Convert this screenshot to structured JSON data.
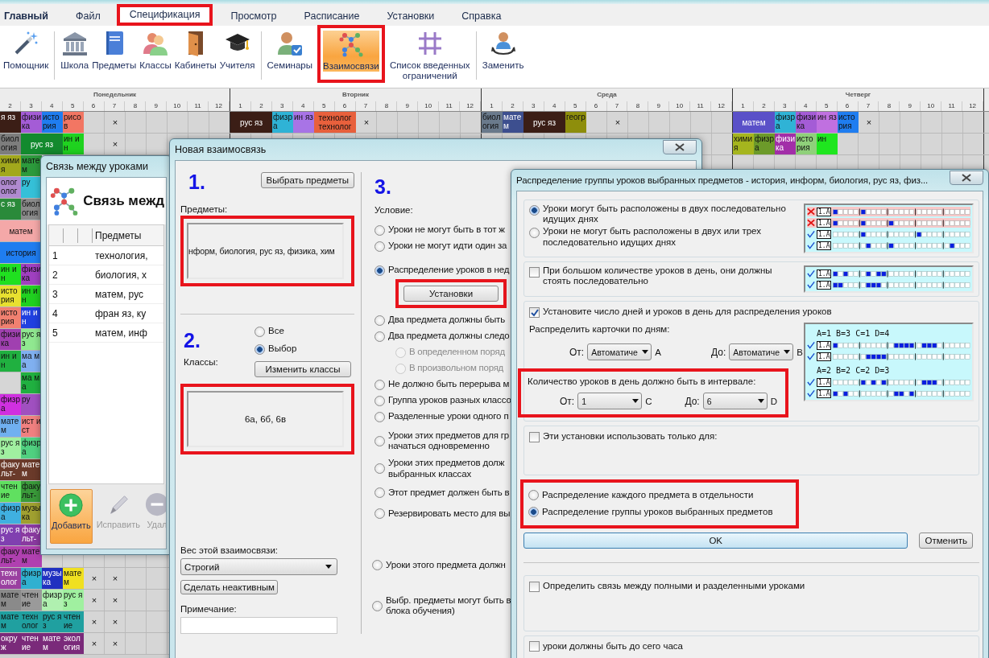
{
  "menu": [
    {
      "kind": "app",
      "label": "Главный",
      "selected": false,
      "highlighted": false
    },
    {
      "kind": "tab",
      "label": "Файл",
      "selected": false,
      "highlighted": false
    },
    {
      "kind": "tab",
      "label": "Спецификация",
      "selected": true,
      "highlighted": true
    },
    {
      "kind": "tab",
      "label": "Просмотр",
      "selected": false,
      "highlighted": false
    },
    {
      "kind": "tab",
      "label": "Расписание",
      "selected": false,
      "highlighted": false
    },
    {
      "kind": "tab",
      "label": "Установки",
      "selected": false,
      "highlighted": false
    },
    {
      "kind": "tab",
      "label": "Справка",
      "selected": false,
      "highlighted": false
    }
  ],
  "ribbon": [
    {
      "kind": "button",
      "label": "Помощник",
      "selected": false,
      "highlighted": false
    },
    {
      "kind": "separator"
    },
    {
      "kind": "button",
      "label": "Школа",
      "selected": false,
      "highlighted": false
    },
    {
      "kind": "button",
      "label": "Предметы",
      "selected": false,
      "highlighted": false
    },
    {
      "kind": "button",
      "label": "Классы",
      "selected": false,
      "highlighted": false
    },
    {
      "kind": "button",
      "label": "Кабинеты",
      "selected": false,
      "highlighted": false
    },
    {
      "kind": "button",
      "label": "Учителя",
      "selected": false,
      "highlighted": false
    },
    {
      "kind": "separator"
    },
    {
      "kind": "button",
      "label": "Семинары",
      "selected": false,
      "highlighted": false
    },
    {
      "kind": "button",
      "label": "Взаимосвязи",
      "selected": true,
      "highlighted": true
    },
    {
      "kind": "button",
      "label": "Список введенных ограничений",
      "selected": false,
      "highlighted": false
    },
    {
      "kind": "separator"
    },
    {
      "kind": "button",
      "label": "Заменить",
      "selected": false,
      "highlighted": false
    }
  ],
  "timetable": {
    "days": [
      {
        "name": "Понедельник",
        "periods": [
          "2",
          "3",
          "4",
          "5",
          "6",
          "7",
          "8",
          "9",
          "10",
          "11",
          "12"
        ]
      },
      {
        "name": "Вторник",
        "periods": [
          "1",
          "2",
          "3",
          "4",
          "5",
          "6",
          "7",
          "8",
          "9",
          "10",
          "11",
          "12"
        ]
      },
      {
        "name": "Среда",
        "periods": [
          "1",
          "2",
          "3",
          "4",
          "5",
          "6",
          "7",
          "8",
          "9",
          "10",
          "11",
          "12"
        ]
      },
      {
        "name": "Четверг",
        "periods": [
          "1",
          "2",
          "3",
          "4",
          "5",
          "6",
          "7",
          "8",
          "9",
          "10",
          "11",
          "12"
        ]
      }
    ],
    "rows": [
      {
        "monday": [
          {
            "kind": "lesson",
            "text": "я яз",
            "color": "#3b1e16"
          },
          {
            "kind": "lesson",
            "text": "физика",
            "color": "#a45cd6"
          },
          {
            "kind": "lesson",
            "text": "история",
            "color": "#1f7df0"
          },
          {
            "kind": "lesson",
            "text": "рисов",
            "color": "#f27663"
          },
          {
            "kind": "empty"
          },
          {
            "kind": "mark",
            "text": "×"
          }
        ],
        "tuesday": [
          {
            "kind": "double",
            "text": "рус яз",
            "color": "#3b1e16"
          },
          {
            "kind": "lesson",
            "text": "физра",
            "color": "#2fb3d6"
          },
          {
            "kind": "lesson",
            "text": "ин яз",
            "color": "#a874e6"
          },
          {
            "kind": "double",
            "text": "технолог технолог",
            "color": "#e8603c"
          },
          {
            "kind": "mark",
            "text": "×"
          }
        ],
        "wednesday": [
          {
            "kind": "lesson",
            "text": "биология",
            "color": "#6a7a8c"
          },
          {
            "kind": "lesson",
            "text": "матем",
            "color": "#3d4f8f"
          },
          {
            "kind": "double",
            "text": "рус яз",
            "color": "#3b1e16"
          },
          {
            "kind": "lesson",
            "text": "геогр",
            "color": "#8e8e0c"
          },
          {
            "kind": "empty"
          },
          {
            "kind": "mark",
            "text": "×"
          }
        ],
        "thursday": [
          {
            "kind": "double",
            "text": "матем",
            "color": "#5a50c8"
          },
          {
            "kind": "lesson",
            "text": "физра",
            "color": "#2fb3d6"
          },
          {
            "kind": "lesson",
            "text": "физика",
            "color": "#a45cd6"
          },
          {
            "kind": "lesson",
            "text": "ин яз",
            "color": "#c070e0"
          },
          {
            "kind": "lesson",
            "text": "история",
            "color": "#1f7df0"
          },
          {
            "kind": "mark",
            "text": "×"
          }
        ]
      },
      {
        "monday": [
          {
            "kind": "lesson",
            "text": "биология",
            "color": "#7d7d7d"
          },
          {
            "kind": "double",
            "text": "рус яз",
            "color": "#138a2e"
          },
          {
            "kind": "lesson",
            "text": "ин ин",
            "color": "#1fd21f"
          },
          {
            "kind": "empty"
          },
          {
            "kind": "mark",
            "text": "×"
          }
        ],
        "thursday": [
          {
            "kind": "lesson",
            "text": "химия",
            "color": "#a5b51e"
          },
          {
            "kind": "lesson",
            "text": "физра",
            "color": "#6c9a2a"
          },
          {
            "kind": "lesson",
            "text": "физика",
            "color": "#a22ea8"
          },
          {
            "kind": "lesson",
            "text": "история",
            "color": "#8fd07a"
          },
          {
            "kind": "lesson",
            "text": "ин",
            "color": "#1fe61f"
          }
        ]
      },
      {
        "monday": [
          {
            "kind": "lesson",
            "text": "химия",
            "color": "#a2a81c"
          },
          {
            "kind": "lesson",
            "text": "матем",
            "color": "#2c9a3c"
          }
        ]
      },
      {
        "monday": [
          {
            "kind": "lesson",
            "text": "олог олог",
            "color": "#b08ad0"
          },
          {
            "kind": "lesson",
            "text": "ру",
            "color": "#35c0d8"
          }
        ]
      },
      {
        "monday": [
          {
            "kind": "lesson",
            "text": "с яз",
            "color": "#2a8a3a"
          },
          {
            "kind": "lesson",
            "text": "биология",
            "color": "#8a8a8a"
          }
        ]
      },
      {
        "monday": [
          {
            "kind": "double",
            "text": "матем",
            "color": "#f4a8a8"
          }
        ]
      },
      {
        "monday": [
          {
            "kind": "double",
            "text": "история",
            "color": "#1f7df0"
          }
        ]
      },
      {
        "monday": [
          {
            "kind": "lesson",
            "text": "ин ин",
            "color": "#20e020"
          },
          {
            "kind": "lesson",
            "text": "физика",
            "color": "#a040c0"
          }
        ]
      },
      {
        "monday": [
          {
            "kind": "lesson",
            "text": "история",
            "color": "#e8e030"
          },
          {
            "kind": "lesson",
            "text": "ин ин",
            "color": "#20d020"
          }
        ]
      },
      {
        "monday": [
          {
            "kind": "lesson",
            "text": "история",
            "color": "#f08070"
          },
          {
            "kind": "lesson",
            "text": "ин ин",
            "color": "#2040e0"
          }
        ]
      },
      {
        "monday": [
          {
            "kind": "lesson",
            "text": "физика",
            "color": "#a040b0"
          },
          {
            "kind": "lesson",
            "text": "рус яз",
            "color": "#90e890"
          }
        ]
      },
      {
        "monday": [
          {
            "kind": "lesson",
            "text": "ин ин",
            "color": "#20b040"
          },
          {
            "kind": "lesson",
            "text": "ма ма",
            "color": "#80b0f0"
          }
        ]
      },
      {
        "monday": [
          {
            "kind": "empty"
          },
          {
            "kind": "lesson",
            "text": "ма ма",
            "color": "#20b040"
          }
        ]
      },
      {
        "monday": [
          {
            "kind": "lesson",
            "text": "физра",
            "color": "#d030e0"
          },
          {
            "kind": "lesson",
            "text": "ру",
            "color": "#a050c0"
          }
        ]
      },
      {
        "monday": [
          {
            "kind": "lesson",
            "text": "матем",
            "color": "#70b0f0"
          },
          {
            "kind": "lesson",
            "text": "ист ист",
            "color": "#f08080"
          }
        ]
      },
      {
        "monday": [
          {
            "kind": "lesson",
            "text": "рус яз",
            "color": "#a0f0a0"
          },
          {
            "kind": "lesson",
            "text": "физра",
            "color": "#50d080"
          }
        ]
      },
      {
        "monday": [
          {
            "kind": "lesson",
            "text": "факульт-",
            "color": "#6a3a2a"
          },
          {
            "kind": "lesson",
            "text": "матем",
            "color": "#6a3a2a"
          }
        ]
      },
      {
        "monday": [
          {
            "kind": "lesson",
            "text": "чтение",
            "color": "#60e060"
          },
          {
            "kind": "lesson",
            "text": "факульт-",
            "color": "#3a9a3a"
          }
        ]
      },
      {
        "monday": [
          {
            "kind": "lesson",
            "text": "физра",
            "color": "#40b0e0"
          },
          {
            "kind": "lesson",
            "text": "музыка",
            "color": "#a0a030"
          }
        ]
      },
      {
        "monday": [
          {
            "kind": "lesson",
            "text": "рус яз",
            "color": "#8040b0"
          },
          {
            "kind": "lesson",
            "text": "факульт-",
            "color": "#8a3aa0"
          }
        ]
      },
      {
        "monday": [
          {
            "kind": "lesson",
            "text": "факульт-",
            "color": "#b040b0"
          },
          {
            "kind": "lesson",
            "text": "матем",
            "color": "#b040b0"
          }
        ]
      },
      {
        "monday": [
          {
            "kind": "lesson",
            "text": "технолог",
            "color": "#9a40a0"
          },
          {
            "kind": "lesson",
            "text": "физра",
            "color": "#30b0d0"
          },
          {
            "kind": "lesson",
            "text": "музыка",
            "color": "#2030c0"
          },
          {
            "kind": "lesson",
            "text": "матем",
            "color": "#f0e020"
          },
          {
            "kind": "mark",
            "text": "×"
          },
          {
            "kind": "mark",
            "text": "×"
          }
        ]
      },
      {
        "monday": [
          {
            "kind": "lesson",
            "text": "матем",
            "color": "#8a8a8a"
          },
          {
            "kind": "lesson",
            "text": "чтение",
            "color": "#9a9a9a"
          },
          {
            "kind": "lesson",
            "text": "физра",
            "color": "#b0f0b0"
          },
          {
            "kind": "lesson",
            "text": "рус яз",
            "color": "#a0f0a0"
          },
          {
            "kind": "mark",
            "text": "×"
          },
          {
            "kind": "mark",
            "text": "×"
          }
        ]
      },
      {
        "monday": [
          {
            "kind": "lesson",
            "text": "матем",
            "color": "#20a0a0"
          },
          {
            "kind": "lesson",
            "text": "технолог",
            "color": "#20a0a0"
          },
          {
            "kind": "lesson",
            "text": "рус яз",
            "color": "#20a0a0"
          },
          {
            "kind": "lesson",
            "text": "чтение",
            "color": "#20a0a0"
          },
          {
            "kind": "mark",
            "text": "×"
          },
          {
            "kind": "mark",
            "text": "×"
          }
        ]
      },
      {
        "monday": [
          {
            "kind": "lesson",
            "text": "окруж",
            "color": "#7a2a7a"
          },
          {
            "kind": "lesson",
            "text": "чтение",
            "color": "#7a2a7a"
          },
          {
            "kind": "lesson",
            "text": "матем",
            "color": "#7a2a7a"
          },
          {
            "kind": "lesson",
            "text": "экология",
            "color": "#7a2a7a"
          },
          {
            "kind": "mark",
            "text": "×"
          },
          {
            "kind": "mark",
            "text": "×"
          }
        ]
      }
    ]
  },
  "lesson_links": {
    "title": "Связь между уроками",
    "heading": "Связь межд",
    "column_4": "Предметы",
    "rows": [
      {
        "number": "1",
        "subjects": "технология,"
      },
      {
        "number": "2",
        "subjects": "биология, х"
      },
      {
        "number": "3",
        "subjects": "матем, рус"
      },
      {
        "number": "4",
        "subjects": "фран яз, ку"
      },
      {
        "number": "5",
        "subjects": "матем, инф"
      }
    ],
    "toolbar": [
      {
        "label": "Добавить",
        "selected": true,
        "disabled": false
      },
      {
        "label": "Исправить",
        "selected": false,
        "disabled": true
      },
      {
        "label": "Удал",
        "selected": false,
        "disabled": true
      }
    ]
  },
  "new_link": {
    "title": "Новая взаимосвязь",
    "step_1": "1.",
    "choose_subjects": "Выбрать предметы",
    "subjects_label": "Предметы:",
    "subjects": {
      "value": "нформ, биология, рус яз, физика, хим",
      "highlighted": true
    },
    "step_2": "2.",
    "classes_label": "Классы:",
    "class_scope": [
      {
        "label": "Все",
        "selected": false
      },
      {
        "label": "Выбор",
        "selected": true
      }
    ],
    "change_classes": "Изменить классы",
    "classes": {
      "value": "6а, 6б, 6в",
      "highlighted": true
    },
    "weight_label": "Вес этой взаимосвязи:",
    "weight": "Строгий",
    "deactivate": "Сделать неактивным",
    "note_label": "Примечание:",
    "step_3": "3.",
    "condition_label": "Условие:",
    "conditions": [
      {
        "kind": "radio",
        "label": "Уроки не могут быть в тот ж",
        "selected": false
      },
      {
        "kind": "radio",
        "label": "Уроки не могут идти один за",
        "selected": false
      },
      {
        "kind": "radio",
        "label": "Распределение уроков в нед",
        "selected": true
      },
      {
        "kind": "button",
        "label": "Установки",
        "highlighted": true
      },
      {
        "kind": "radio",
        "label": "Два предмета должны быть",
        "selected": false
      },
      {
        "kind": "radio",
        "label": "Два предмета должны следо",
        "selected": false
      },
      {
        "kind": "subradio",
        "label": "В определенном поряд",
        "selected": false,
        "disabled": true
      },
      {
        "kind": "subradio",
        "label": "В произвольном поряд",
        "selected": false,
        "disabled": true
      },
      {
        "kind": "radio",
        "label": "Не должно быть перерыва м",
        "selected": false
      },
      {
        "kind": "radio",
        "label": "Группа уроков разных классо",
        "selected": false
      },
      {
        "kind": "radio",
        "label": "Разделенные уроки одного п",
        "selected": false
      },
      {
        "kind": "radio",
        "label": "Уроки этих предметов для гр\nначаться одновременно",
        "selected": false
      },
      {
        "kind": "radio",
        "label": "Уроки этих предметов долж\nвыбранных классах",
        "selected": false
      },
      {
        "kind": "radio",
        "label": "Этот предмет должен быть в",
        "selected": false
      },
      {
        "kind": "radio",
        "label": "Резервировать место для вы",
        "selected": false
      },
      {
        "kind": "radio",
        "label": "Уроки этого предмета должн",
        "selected": false
      },
      {
        "kind": "radio",
        "label": "Выбр. предметы могут быть в\nблока обучения)",
        "selected": false
      }
    ]
  },
  "distribution": {
    "title": "Распределение группы уроков выбранных предметов - история, информ, биология, рус яз, физ...",
    "consecutive": {
      "options": [
        {
          "label": "Уроки могут быть расположены в двух последовательно идущих днях",
          "selected": true
        },
        {
          "label": "Уроки не могут быть расположены в двух или трех последовательно идущих днях",
          "selected": false
        }
      ],
      "diagram": [
        {
          "kind": "row",
          "ok": false,
          "label": "1.A"
        },
        {
          "kind": "row",
          "ok": false,
          "label": "1.A"
        },
        {
          "kind": "row",
          "ok": true,
          "label": "1.A"
        },
        {
          "kind": "row",
          "ok": true,
          "label": "1.A"
        }
      ]
    },
    "together": {
      "label": "При большом количестве уроков в день, они должны стоять последовательно",
      "checked": false,
      "diagram": [
        {
          "kind": "row",
          "ok": true,
          "label": "1.A"
        },
        {
          "kind": "row",
          "ok": true,
          "label": "1.A"
        }
      ]
    },
    "limits": {
      "label": "Установите число дней и уроков в день для распределения уроков",
      "checked": true,
      "days_label": "Распределить карточки по дням:",
      "days": [
        {
          "label": "От:",
          "value": "Автоматиче",
          "letter": "A"
        },
        {
          "label": "До:",
          "value": "Автоматиче",
          "letter": "B"
        }
      ],
      "lessons_label": "Количество уроков в день должно быть в интервале:",
      "lessons_highlighted": true,
      "lessons": [
        {
          "label": "От:",
          "value": "1",
          "letter": "C"
        },
        {
          "label": "До:",
          "value": "6",
          "letter": "D"
        }
      ],
      "diagram": [
        {
          "kind": "caption",
          "text": "A=1 B=3 C=1 D=4"
        },
        {
          "kind": "row",
          "ok": true,
          "label": "1.A"
        },
        {
          "kind": "row",
          "ok": true,
          "label": "1.A"
        },
        {
          "kind": "caption",
          "text": "A=2 B=2 C=2 D=3"
        },
        {
          "kind": "row",
          "ok": true,
          "label": "1.A"
        },
        {
          "kind": "row",
          "ok": true,
          "label": "1.A"
        }
      ]
    },
    "only_for": {
      "label": "Эти установки использовать только для:",
      "checked": false
    },
    "mode": {
      "highlighted": true,
      "options": [
        {
          "label": "Распределение каждого предмета в отдельности",
          "selected": false
        },
        {
          "label": "Распределение группы уроков выбранных предметов",
          "selected": true
        }
      ]
    },
    "ok": "OK",
    "cancel": "Отменить",
    "full_split": {
      "label": "Определить связь между полными и разделенными уроками",
      "checked": false
    },
    "deadline": {
      "label": "уроки должны быть до сего часа",
      "checked": false
    }
  }
}
